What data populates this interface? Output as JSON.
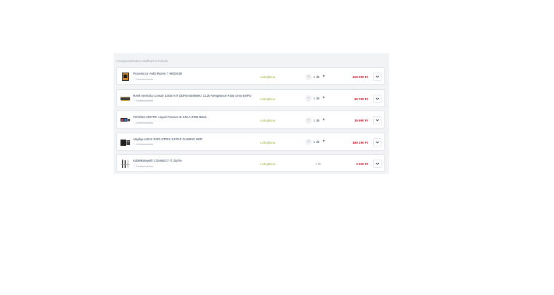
{
  "panel": {
    "caption": "A megrendelésben található termékek"
  },
  "common": {
    "favorite_label": "Kedvencekhez",
    "minus": "−",
    "plus": "+"
  },
  "items": [
    {
      "name": "Processzor AMD Ryzen 7 9800X3D",
      "stock": "Leltujtárna",
      "qty": "1 db",
      "price": "219 290 Ft",
      "icon": "cpu-box-icon"
    },
    {
      "name": "RAM memória Corsair 32GB KIT DDR5 6000MHz CL30 Vengeance RGB Grey EXPO",
      "stock": "Leltujtárna",
      "qty": "1 db",
      "price": "55 790 Ft",
      "icon": "ram-module-icon"
    },
    {
      "name": "Vízhűtés ARCTIC Liquid Freezer III 240 A-RGB Black",
      "stock": "Leltujtárna",
      "qty": "1 db",
      "price": "35 990 Ft",
      "icon": "liquid-cooler-icon"
    },
    {
      "name": "Alaplap ASUS ROG STRIX X870-F GAMING WIFI",
      "stock": "Leltujtárna",
      "qty": "1 db",
      "price": "169 190 Ft",
      "icon": "motherboard-box-icon"
    },
    {
      "name": "Kábelkötegelő CONNECT IT ZipTie",
      "stock": "Leltujtárna",
      "qty": "1 db",
      "price": "3 200 Ft",
      "icon": "zip-tie-icon"
    }
  ]
}
